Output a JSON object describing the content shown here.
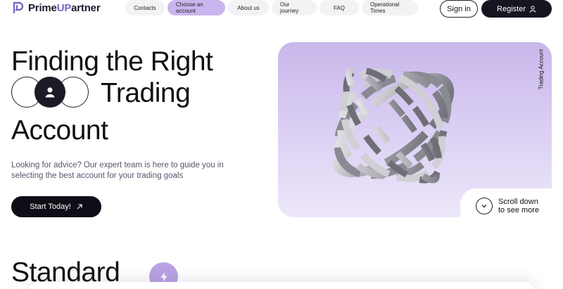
{
  "logo": {
    "text_prefix": "Prime",
    "text_accent": "UP",
    "text_suffix": "artner",
    "icon": "logo-mark-icon"
  },
  "nav": {
    "items": [
      {
        "label": "Contacts"
      },
      {
        "label": "Choose an account",
        "active": true
      },
      {
        "label": "About us"
      },
      {
        "label": "Our journey"
      },
      {
        "label": "FAQ"
      },
      {
        "label": "Operational Times"
      }
    ]
  },
  "auth": {
    "signin_label": "Sign in",
    "register_label": "Register",
    "register_icon": "user-icon"
  },
  "hero": {
    "line1": "Finding the Right",
    "line2": "Trading",
    "line3": "Account",
    "description": "Looking for advice? Our expert team is here to guide you in selecting the best account for your trading goals",
    "cta_label": "Start Today!",
    "cta_icon": "arrow-up-right-icon"
  },
  "visual": {
    "vertical_label": "Trading Account",
    "scroll_line1": "Scroll down",
    "scroll_line2": "to see more",
    "scroll_icon": "chevron-down-icon"
  },
  "section": {
    "title": "Standard",
    "icon": "bolt-icon"
  },
  "colors": {
    "accent": "#c9b6ee",
    "dark": "#15141f",
    "panel": "#d9cdf3",
    "bolt_bg": "#b9a2e3"
  }
}
